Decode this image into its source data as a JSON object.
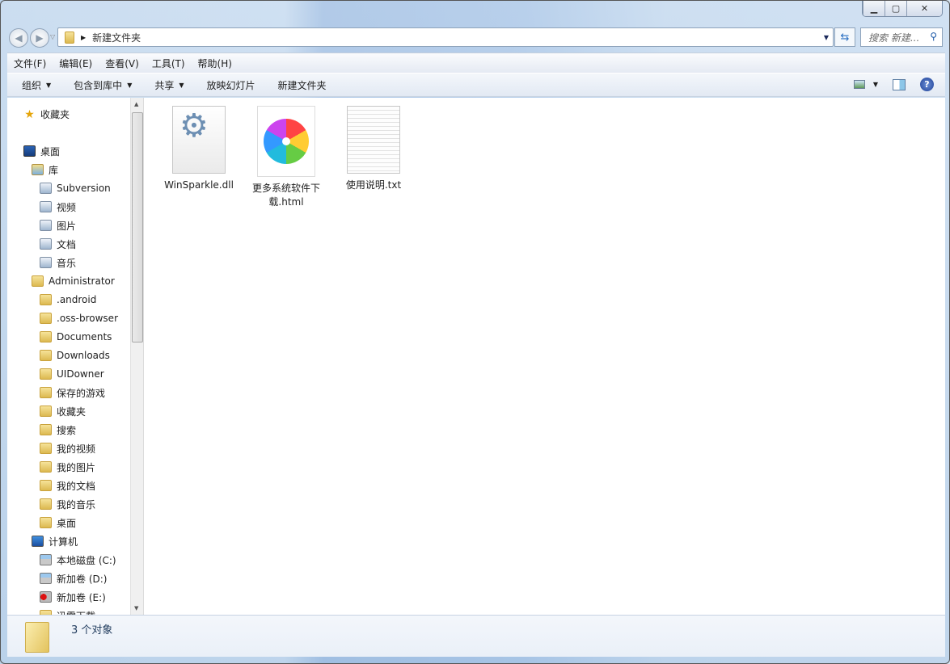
{
  "window": {
    "caption": {
      "minimize": "▁",
      "maximize": "▢",
      "close": "✕"
    }
  },
  "address": {
    "path": "新建文件夹",
    "search_placeholder": "搜索 新建..."
  },
  "menu": [
    "文件(F)",
    "编辑(E)",
    "查看(V)",
    "工具(T)",
    "帮助(H)"
  ],
  "toolbar": {
    "organize": "组织",
    "include": "包含到库中",
    "share": "共享",
    "slideshow": "放映幻灯片",
    "new_folder": "新建文件夹"
  },
  "sidebar": {
    "items": [
      {
        "label": "收藏夹",
        "icon": "star-icon",
        "level": 0
      },
      {
        "label": "桌面",
        "icon": "desktop-icon",
        "level": 0
      },
      {
        "label": "库",
        "icon": "library-icon",
        "level": 1
      },
      {
        "label": "Subversion",
        "icon": "library-doc-icon",
        "level": 2
      },
      {
        "label": "视频",
        "icon": "video-icon",
        "level": 2
      },
      {
        "label": "图片",
        "icon": "picture-icon",
        "level": 2
      },
      {
        "label": "文档",
        "icon": "document-icon",
        "level": 2
      },
      {
        "label": "音乐",
        "icon": "music-icon",
        "level": 2
      },
      {
        "label": "Administrator",
        "icon": "user-folder-icon",
        "level": 1
      },
      {
        "label": ".android",
        "icon": "folder-icon",
        "level": 2
      },
      {
        "label": ".oss-browser",
        "icon": "folder-icon",
        "level": 2
      },
      {
        "label": "Documents",
        "icon": "folder-icon",
        "level": 2
      },
      {
        "label": "Downloads",
        "icon": "folder-icon",
        "level": 2
      },
      {
        "label": "UIDowner",
        "icon": "folder-icon",
        "level": 2
      },
      {
        "label": "保存的游戏",
        "icon": "folder-icon",
        "level": 2
      },
      {
        "label": "收藏夹",
        "icon": "folder-icon",
        "level": 2
      },
      {
        "label": "搜索",
        "icon": "folder-icon",
        "level": 2
      },
      {
        "label": "我的视频",
        "icon": "folder-icon",
        "level": 2
      },
      {
        "label": "我的图片",
        "icon": "folder-icon",
        "level": 2
      },
      {
        "label": "我的文档",
        "icon": "folder-icon",
        "level": 2
      },
      {
        "label": "我的音乐",
        "icon": "folder-icon",
        "level": 2
      },
      {
        "label": "桌面",
        "icon": "folder-icon",
        "level": 2
      },
      {
        "label": "计算机",
        "icon": "computer-icon",
        "level": 1
      },
      {
        "label": "本地磁盘 (C:)",
        "icon": "drive-icon",
        "level": 2
      },
      {
        "label": "新加卷 (D:)",
        "icon": "drive-icon",
        "level": 2
      },
      {
        "label": "新加卷 (E:)",
        "icon": "drive-error-icon",
        "level": 2
      },
      {
        "label": "迅雷下载",
        "icon": "folder-icon",
        "level": 2
      }
    ]
  },
  "files": [
    {
      "name": "WinSparkle.dll",
      "icon": "dll-gear-icon"
    },
    {
      "name": "更多系统软件下载.html",
      "icon": "browser-pinwheel-icon"
    },
    {
      "name": "使用说明.txt",
      "icon": "text-file-icon"
    }
  ],
  "status": {
    "count": "3 个对象"
  }
}
